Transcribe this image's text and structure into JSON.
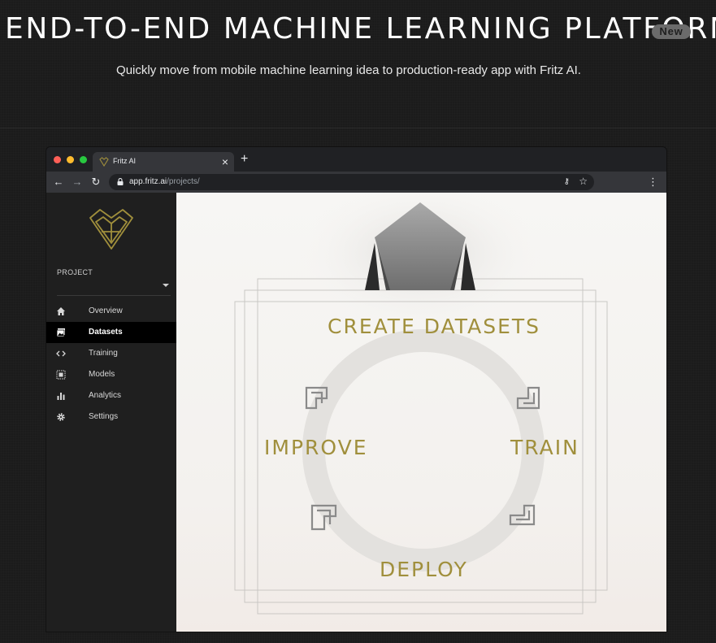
{
  "hero": {
    "title": "END-TO-END MACHINE LEARNING PLATFORM",
    "badge": "New",
    "subtitle": "Quickly move from mobile machine learning idea to production-ready app with Fritz AI."
  },
  "browser": {
    "tab_title": "Fritz AI",
    "tab_close": "×",
    "new_tab": "+",
    "url_host": "app.fritz.ai",
    "url_path": "/projects/",
    "icons": [
      "back-icon",
      "forward-icon",
      "reload-icon",
      "lock-icon",
      "key-icon",
      "star-icon",
      "menu-icon"
    ]
  },
  "sidebar": {
    "project_label": "PROJECT",
    "items": [
      {
        "label": "Overview",
        "icon": "home-icon",
        "active": false
      },
      {
        "label": "Datasets",
        "icon": "image-icon",
        "active": true
      },
      {
        "label": "Training",
        "icon": "code-icon",
        "active": false
      },
      {
        "label": "Models",
        "icon": "model-icon",
        "active": false
      },
      {
        "label": "Analytics",
        "icon": "bar-chart-icon",
        "active": false
      },
      {
        "label": "Settings",
        "icon": "gear-icon",
        "active": false
      }
    ]
  },
  "cycle": {
    "steps": [
      "CREATE DATASETS",
      "TRAIN",
      "DEPLOY",
      "IMPROVE"
    ]
  },
  "colors": {
    "accent_gold": "#a08f3c",
    "page_bg": "#1b1b1b",
    "sidebar_bg": "#1f1f1f",
    "content_bg": "#f3f1ee"
  }
}
